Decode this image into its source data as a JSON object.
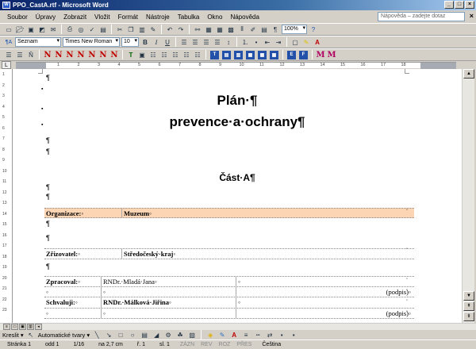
{
  "window": {
    "title": "PPO_CastA.rtf - Microsoft Word",
    "app_icon": "W",
    "min": "_",
    "max": "□",
    "close": "×"
  },
  "menubar": {
    "items": [
      "Soubor",
      "Úpravy",
      "Zobrazit",
      "Vložit",
      "Formát",
      "Nástroje",
      "Tabulka",
      "Okno",
      "Nápověda"
    ],
    "help_placeholder": "Nápověda – zadejte dotaz",
    "close_doc": "×"
  },
  "toolbar_format": {
    "style": "Seznam",
    "style_icon": "¶A",
    "font": "Times New Roman",
    "size": "10",
    "bold": "B",
    "italic": "I",
    "underline": "U",
    "zoom": "100%"
  },
  "ruler": {
    "corner": "L",
    "h_ticks": [
      "1",
      "2",
      "3",
      "4",
      "5",
      "6",
      "7",
      "8",
      "9",
      "10",
      "11",
      "12",
      "13",
      "14",
      "15",
      "16",
      "17",
      "18"
    ],
    "v_ticks": [
      "1",
      "2",
      "3",
      "4",
      "5",
      "6",
      "7",
      "8",
      "9",
      "10",
      "11",
      "12",
      "13",
      "14",
      "15",
      "16",
      "17",
      "18",
      "19",
      "20",
      "21",
      "22",
      "23"
    ]
  },
  "document": {
    "title_line1": "Plán·¶",
    "title_line2": "prevence·a·ochrany¶",
    "subtitle": "Část·A¶",
    "para": "¶",
    "rows": [
      {
        "label": "Organizace:◦",
        "value": "Muzeum◦"
      },
      {
        "label": "Zřizovatel:◦",
        "value": "Středočeský·kraj◦"
      },
      {
        "label": "Zpracoval:◦",
        "value": "RNDr.·Mladá·Jana◦",
        "extra": "◦",
        "sign": "(podpis)◦"
      },
      {
        "label": "Schvaluji:◦",
        "value": "RNDr.·Málková·Jiřina◦",
        "extra": "◦",
        "sign": "(podpis)◦"
      }
    ],
    "cell_end": "◦",
    "row_end": "◦"
  },
  "draw_toolbar": {
    "draw": "Kreslit ▾",
    "autoshapes": "Automatické tvary ▾"
  },
  "statusbar": {
    "page": "Stránka 1",
    "section": "odd 1",
    "pages": "1/16",
    "position": "na 2,7 cm",
    "line": "ř. 1",
    "column": "sl. 1",
    "zazn": "ZÁZN",
    "rev": "REV",
    "roz": "ROZ",
    "pres": "PŘES",
    "language": "Čeština"
  },
  "colors": {
    "org_row_bg": "#fcd5b4",
    "titlebar": "#0a246a"
  }
}
